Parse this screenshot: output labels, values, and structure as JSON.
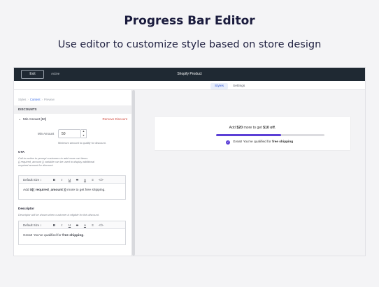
{
  "hero": {
    "title": "Progress Bar Editor",
    "subtitle": "Use editor to customize style based on store design"
  },
  "topbar": {
    "exit_label": "Exit",
    "status_label": "Active",
    "title": "Shopify Product"
  },
  "tabs": [
    {
      "label": "Styles",
      "active": true
    },
    {
      "label": "Settings",
      "active": false
    }
  ],
  "breadcrumbs": [
    "Styles",
    "Content",
    "Preview"
  ],
  "sections": {
    "discounts": {
      "heading": "DISCOUNTS",
      "min_amount_title": "Min Amount [50]",
      "remove_label": "Remove Discount",
      "min_label": "Min Amount",
      "min_value": "50",
      "min_help": "Minimum amount to qualify for discount."
    },
    "cta": {
      "label": "CTA",
      "help_1": "Call-to-action to prompt customers to add more cart items.",
      "help_2": "{{ required_amount }} variable can be used to display additional",
      "help_3": "required amount for discount.",
      "text_pre": "Add ",
      "text_var": "${{ required_amount }}",
      "text_post": " more to get free shipping."
    },
    "descriptor": {
      "label": "Descriptor",
      "help": "Descriptor will be shown when customer is eligible for this discount.",
      "text_pre": "Great! You've qualified for ",
      "text_bold": "free shipping",
      "text_post": "."
    }
  },
  "toolbar": {
    "size_label": "Default Size",
    "size_caret": "↕",
    "bold": "B",
    "italic": "I",
    "underline": "U",
    "strike": "S",
    "color": "A",
    "clear": "≡",
    "code": "</>"
  },
  "preview": {
    "msg_pre": "Add ",
    "msg_amount": "$20",
    "msg_mid": " more to get ",
    "msg_reward": "$10 off",
    "msg_post": ".",
    "progress": 0.6,
    "qual_pre": "Great! You've qualified for ",
    "qual_bold": "free shipping",
    "check_glyph": "✓"
  },
  "colors": {
    "topbar": "#1f2933",
    "accent": "#3d6ee8",
    "remove": "#d0473c",
    "progress": "#5b3fd6"
  }
}
